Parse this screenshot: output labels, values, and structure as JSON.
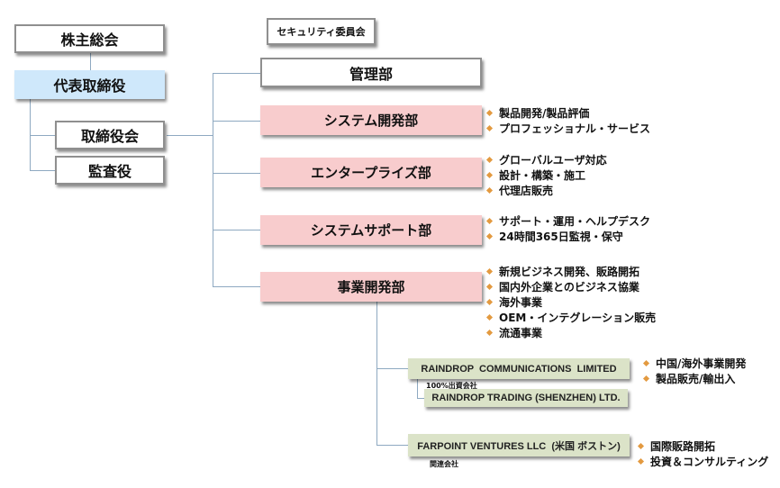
{
  "chart": {
    "shareholders": "株主総会",
    "ceo": "代表取締役",
    "board": "取締役会",
    "auditor": "監査役",
    "security_committee": "セキュリティ委員会",
    "departments": [
      {
        "name": "管理部",
        "items": []
      },
      {
        "name": "システム開発部",
        "items": [
          "製品開発/製品評価",
          "プロフェッショナル・サービス"
        ]
      },
      {
        "name": "エンタープライズ部",
        "items": [
          "グローバルユーザ対応",
          "設計・構築・施工",
          "代理店販売"
        ]
      },
      {
        "name": "システムサポート部",
        "items": [
          "サポート・運用・ヘルプデスク",
          "24時間365日監視・保守"
        ]
      },
      {
        "name": "事業開発部",
        "items": [
          "新規ビジネス開発、販路開拓",
          "国内外企業とのビジネス協業",
          "海外事業",
          "OEM・インテグレーション販売",
          "流通事業"
        ]
      }
    ],
    "subsidiaries": [
      {
        "name": "RAINDROP  COMMUNICATIONS  LIMITED",
        "items": [
          "中国/海外事業開発",
          "製品販売/輸出入"
        ]
      },
      {
        "name": "RAINDROP TRADING (SHENZHEN) LTD.",
        "note": "100%出資会社"
      },
      {
        "name": "FARPOINT VENTURES LLC  (米国 ボストン)",
        "note": "関連会社",
        "items": [
          "国際販路開拓",
          "投資＆コンサルティング"
        ]
      }
    ]
  },
  "colors": {
    "line": "#8ea9c1",
    "ceo_fill": "#cfe8fb",
    "department_fill": "#f8cccd",
    "subsidiary_fill": "#dbe3c8",
    "bullet": "#e39a40"
  }
}
